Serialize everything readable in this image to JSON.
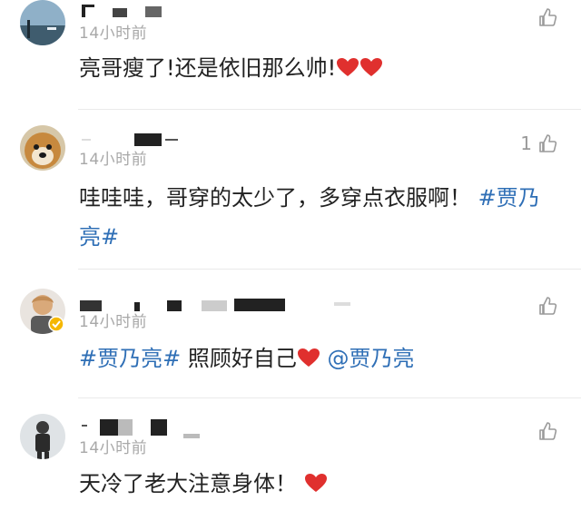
{
  "comments": [
    {
      "time": "14小时前",
      "text": "亮哥瘦了!还是依旧那么帅!",
      "hearts": 2,
      "like_count": ""
    },
    {
      "time": "14小时前",
      "text": "哇哇哇，哥穿的太少了，多穿点衣服啊！ ",
      "tag": "#贾乃亮#",
      "like_count": "1"
    },
    {
      "time": "14小时前",
      "tag": "#贾乃亮#",
      "text": " 照顾好自己",
      "mention": " @贾乃亮",
      "like_count": ""
    },
    {
      "time": "14小时前",
      "text": "天冷了老大注意身体！",
      "like_count": ""
    }
  ],
  "colors": {
    "text": "#222222",
    "time": "#a8a8a8",
    "link": "#2f6fb6",
    "heart": "#e0302e",
    "icon": "#9a9a9a"
  },
  "icons": [
    "thumbs-up-icon",
    "heart-icon",
    "verified-badge-icon"
  ]
}
